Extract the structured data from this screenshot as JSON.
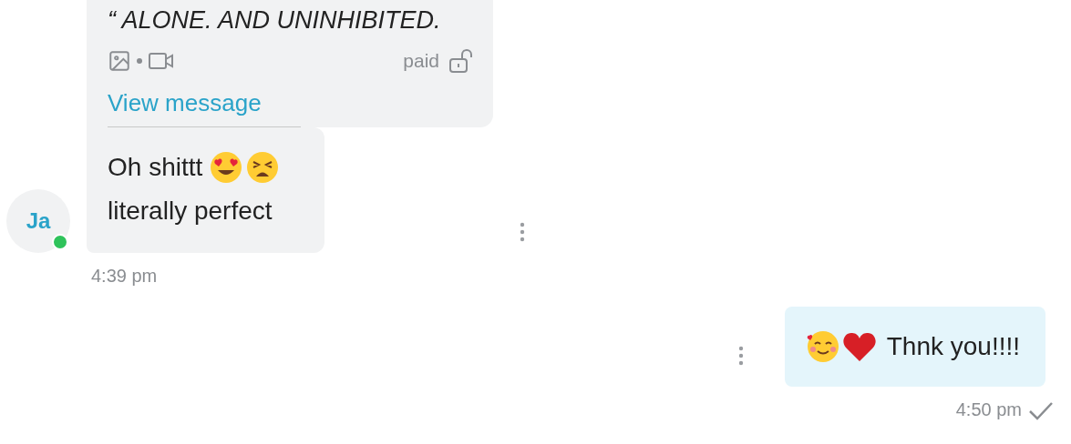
{
  "incoming": {
    "avatar": {
      "initials": "Ja",
      "online": true
    },
    "locked": {
      "text": "“ ALONE. AND UNINHIBITED.",
      "price_label": "paid",
      "link": "View message"
    },
    "lines": [
      {
        "text": "Oh shittt",
        "emojis": [
          {
            "kind": "heart_eyes"
          },
          {
            "kind": "tired"
          }
        ]
      },
      {
        "text": "literally perfect"
      }
    ],
    "time": "4:39 pm"
  },
  "outgoing": {
    "emojis": [
      {
        "kind": "smiling_hearts"
      },
      {
        "kind": "heart"
      }
    ],
    "text": "Thnk you!!!!",
    "time": "4:50 pm",
    "delivered": true
  }
}
